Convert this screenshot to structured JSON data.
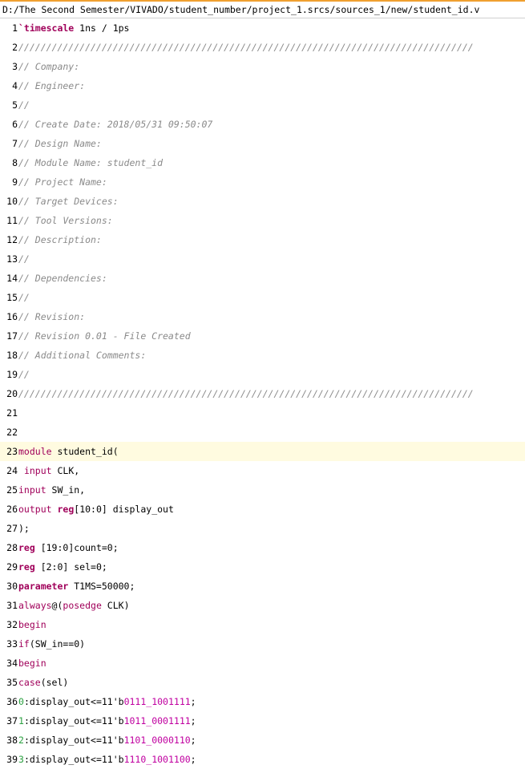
{
  "file_path": "D:/The Second Semester/VIVADO/student_number/project_1.srcs/sources_1/new/student_id.v",
  "highlighted_line": 23,
  "lines": [
    {
      "n": "1",
      "t": [
        [
          "kw",
          "`timescale"
        ],
        [
          "txt",
          " 1ns / 1ps"
        ]
      ]
    },
    {
      "n": "2",
      "t": [
        [
          "cm",
          "//////////////////////////////////////////////////////////////////////////////////"
        ]
      ]
    },
    {
      "n": "3",
      "t": [
        [
          "cm",
          "// Company:"
        ]
      ]
    },
    {
      "n": "4",
      "t": [
        [
          "cm",
          "// Engineer:"
        ]
      ]
    },
    {
      "n": "5",
      "t": [
        [
          "cm",
          "//"
        ]
      ]
    },
    {
      "n": "6",
      "t": [
        [
          "cm",
          "// Create Date: 2018/05/31 09:50:07"
        ]
      ]
    },
    {
      "n": "7",
      "t": [
        [
          "cm",
          "// Design Name:"
        ]
      ]
    },
    {
      "n": "8",
      "t": [
        [
          "cm",
          "// Module Name: student_id"
        ]
      ]
    },
    {
      "n": "9",
      "t": [
        [
          "cm",
          "// Project Name:"
        ]
      ]
    },
    {
      "n": "10",
      "t": [
        [
          "cm",
          "// Target Devices:"
        ]
      ]
    },
    {
      "n": "11",
      "t": [
        [
          "cm",
          "// Tool Versions:"
        ]
      ]
    },
    {
      "n": "12",
      "t": [
        [
          "cm",
          "// Description:"
        ]
      ]
    },
    {
      "n": "13",
      "t": [
        [
          "cm",
          "//"
        ]
      ]
    },
    {
      "n": "14",
      "t": [
        [
          "cm",
          "// Dependencies:"
        ]
      ]
    },
    {
      "n": "15",
      "t": [
        [
          "cm",
          "//"
        ]
      ]
    },
    {
      "n": "16",
      "t": [
        [
          "cm",
          "// Revision:"
        ]
      ]
    },
    {
      "n": "17",
      "t": [
        [
          "cm",
          "// Revision 0.01 - File Created"
        ]
      ]
    },
    {
      "n": "18",
      "t": [
        [
          "cm",
          "// Additional Comments:"
        ]
      ]
    },
    {
      "n": "19",
      "t": [
        [
          "cm",
          "//"
        ]
      ]
    },
    {
      "n": "20",
      "t": [
        [
          "cm",
          "//////////////////////////////////////////////////////////////////////////////////"
        ]
      ]
    },
    {
      "n": "21",
      "t": []
    },
    {
      "n": "22",
      "t": []
    },
    {
      "n": "23",
      "t": [
        [
          "kwn",
          "module"
        ],
        [
          "txt",
          " student_id("
        ]
      ]
    },
    {
      "n": "24",
      "t": [
        [
          "txt",
          " "
        ],
        [
          "kwn",
          "input"
        ],
        [
          "txt",
          " CLK,"
        ]
      ]
    },
    {
      "n": "25",
      "t": [
        [
          "kwn",
          "input"
        ],
        [
          "txt",
          " SW_in,"
        ]
      ]
    },
    {
      "n": "26",
      "t": [
        [
          "kwn",
          "output"
        ],
        [
          "txt",
          " "
        ],
        [
          "kw",
          "reg"
        ],
        [
          "txt",
          "[10:0] display_out"
        ]
      ]
    },
    {
      "n": "27",
      "t": [
        [
          "txt",
          ");"
        ]
      ]
    },
    {
      "n": "28",
      "t": [
        [
          "kw",
          "reg"
        ],
        [
          "txt",
          " [19:0]count=0;"
        ]
      ]
    },
    {
      "n": "29",
      "t": [
        [
          "kw",
          "reg"
        ],
        [
          "txt",
          " [2:0] sel=0;"
        ]
      ]
    },
    {
      "n": "30",
      "t": [
        [
          "kw",
          "parameter"
        ],
        [
          "txt",
          " T1MS=50000;"
        ]
      ]
    },
    {
      "n": "31",
      "t": [
        [
          "kwn",
          "always"
        ],
        [
          "txt",
          "@("
        ],
        [
          "kwn",
          "posedge"
        ],
        [
          "txt",
          " CLK)"
        ]
      ]
    },
    {
      "n": "32",
      "t": [
        [
          "kwn",
          "begin"
        ]
      ]
    },
    {
      "n": "33",
      "t": [
        [
          "kwn",
          "if"
        ],
        [
          "txt",
          "(SW_in==0)"
        ]
      ]
    },
    {
      "n": "34",
      "t": [
        [
          "kwn",
          "begin"
        ]
      ]
    },
    {
      "n": "35",
      "t": [
        [
          "kwn",
          "case"
        ],
        [
          "txt",
          "(sel)"
        ]
      ]
    },
    {
      "n": "36",
      "t": [
        [
          "nm",
          "0"
        ],
        [
          "txt",
          ":display_out<=11'"
        ],
        [
          "txt",
          "b"
        ],
        [
          "num",
          "0111_1001111"
        ],
        [
          "txt",
          ";"
        ]
      ]
    },
    {
      "n": "37",
      "t": [
        [
          "nm",
          "1"
        ],
        [
          "txt",
          ":display_out<=11'"
        ],
        [
          "txt",
          "b"
        ],
        [
          "num",
          "1011_0001111"
        ],
        [
          "txt",
          ";"
        ]
      ]
    },
    {
      "n": "38",
      "t": [
        [
          "nm",
          "2"
        ],
        [
          "txt",
          ":display_out<=11'"
        ],
        [
          "txt",
          "b"
        ],
        [
          "num",
          "1101_0000110"
        ],
        [
          "txt",
          ";"
        ]
      ]
    },
    {
      "n": "39",
      "t": [
        [
          "nm",
          "3"
        ],
        [
          "txt",
          ":display_out<=11'"
        ],
        [
          "txt",
          "b"
        ],
        [
          "num",
          "1110_1001100"
        ],
        [
          "txt",
          ";"
        ]
      ]
    }
  ]
}
